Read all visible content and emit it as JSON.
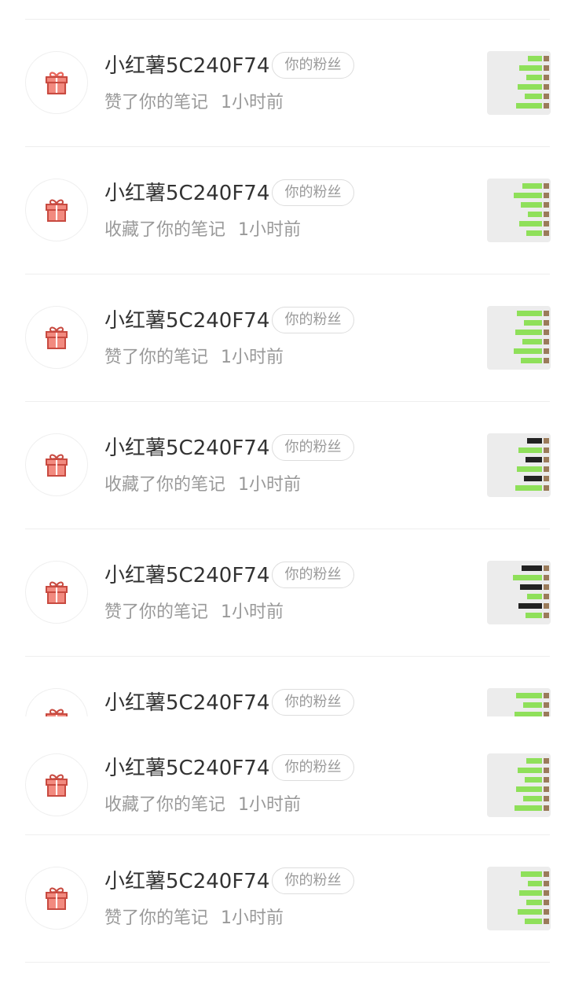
{
  "notifications": [
    {
      "user": "小红薯5C240F74",
      "badge": "你的粉丝",
      "action": "赞了你的笔记",
      "time": "1小时前",
      "thumb_icon": "chat-screenshot-thumbnail-icon"
    },
    {
      "user": "小红薯5C240F74",
      "badge": "你的粉丝",
      "action": "收藏了你的笔记",
      "time": "1小时前",
      "thumb_icon": "chat-screenshot-thumbnail-icon"
    },
    {
      "user": "小红薯5C240F74",
      "badge": "你的粉丝",
      "action": "赞了你的笔记",
      "time": "1小时前",
      "thumb_icon": "chat-screenshot-thumbnail-icon"
    },
    {
      "user": "小红薯5C240F74",
      "badge": "你的粉丝",
      "action": "收藏了你的笔记",
      "time": "1小时前",
      "thumb_icon": "chat-screenshot-thumbnail-icon"
    },
    {
      "user": "小红薯5C240F74",
      "badge": "你的粉丝",
      "action": "赞了你的笔记",
      "time": "1小时前",
      "thumb_icon": "chat-screenshot-thumbnail-icon"
    },
    {
      "user": "小红薯5C240F74",
      "badge": "你的粉丝",
      "action": "",
      "time": "",
      "thumb_icon": "chat-screenshot-thumbnail-icon"
    },
    {
      "user": "小红薯5C240F74",
      "badge": "你的粉丝",
      "action": "收藏了你的笔记",
      "time": "1小时前",
      "thumb_icon": "chat-screenshot-thumbnail-icon"
    },
    {
      "user": "小红薯5C240F74",
      "badge": "你的粉丝",
      "action": "赞了你的笔记",
      "time": "1小时前",
      "thumb_icon": "chat-screenshot-thumbnail-icon"
    }
  ],
  "avatar_icon": "gift-icon",
  "colors": {
    "gift": "#e8655a",
    "thumb_green": "#8fe05a",
    "separator": "#eeeeee"
  }
}
